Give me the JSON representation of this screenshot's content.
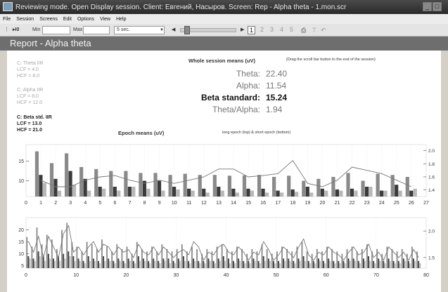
{
  "window": {
    "title": "Reviewing mode. Open Display session. Client: Евгений, Насыров. Screen: Rep - Alpha theta - 1.mon.scr"
  },
  "menu": [
    "File",
    "Session",
    "Screens",
    "Edit",
    "Options",
    "View",
    "Help"
  ],
  "toolbar": {
    "min_label": "Min",
    "max_label": "Max",
    "interval": "5 sec.",
    "pages": [
      "1",
      "2",
      "3",
      "4",
      "5"
    ]
  },
  "report": {
    "title": "Report - Alpha theta"
  },
  "filters": [
    {
      "name": "C: Theta IIR",
      "lcf": "LCF = 4.0",
      "hcf": "HCF = 8.0",
      "color": "#a8a8a8"
    },
    {
      "name": "C: Alpha IIR",
      "lcf": "LCF = 8.0",
      "hcf": "HCF = 12.0",
      "color": "#a8a8a8"
    },
    {
      "name": "C: Beta std. IIR",
      "lcf": "LCF = 13.0",
      "hcf": "HCF = 21.0",
      "color": "#222222"
    }
  ],
  "session": {
    "title": "Whole session means (uV)",
    "hint": "(Drag the scroll bar button to the end of the session)",
    "metrics": [
      {
        "label": "Theta:",
        "value": "22.40",
        "emph": false
      },
      {
        "label": "Alpha:",
        "value": "11.54",
        "emph": false
      },
      {
        "label": "Beta standard:",
        "value": "15.24",
        "emph": true
      },
      {
        "label": "Theta/Alpha:",
        "value": "1.94",
        "emph": false
      }
    ]
  },
  "epoch": {
    "title": "Epoch means (uV)",
    "note": "long epoch (top) & short epoch (bottom)"
  },
  "chart_data": [
    {
      "type": "bar",
      "title": "long epoch",
      "x": [
        1,
        2,
        3,
        4,
        5,
        6,
        7,
        8,
        9,
        10,
        11,
        12,
        13,
        14,
        15,
        16,
        17,
        18,
        19,
        20,
        21,
        22,
        23,
        24,
        25,
        26
      ],
      "xticks": [
        "0",
        "1",
        "2",
        "3",
        "4",
        "5",
        "6",
        "7",
        "8",
        "9",
        "10",
        "11",
        "12",
        "13",
        "14",
        "15",
        "16",
        "17",
        "18",
        "19",
        "20",
        "21",
        "22",
        "23",
        "24",
        "25",
        "26",
        "27"
      ],
      "yticks_left": [
        "10",
        "15"
      ],
      "yticks_right": [
        "1.4",
        "1.6",
        "1.8",
        "2.0"
      ],
      "ylim_left": [
        6,
        18.5
      ],
      "ylim_right": [
        1.3,
        2.05
      ],
      "series": [
        {
          "name": "Theta",
          "color": "#8a8a8a",
          "values": [
            17.5,
            14.5,
            17,
            13.5,
            13,
            12.5,
            12.5,
            12,
            12,
            11.5,
            11.8,
            11.5,
            11.5,
            11.3,
            11.4,
            11.5,
            11,
            11.3,
            10,
            10.5,
            11,
            12,
            10,
            11.8,
            11.5,
            11
          ]
        },
        {
          "name": "Alpha",
          "color": "#3a3a3a",
          "values": [
            11.5,
            10.5,
            12.5,
            10.5,
            8.5,
            8.5,
            8.5,
            10,
            10,
            8.5,
            8,
            8,
            8.5,
            8,
            8,
            8,
            7.5,
            7.8,
            8.5,
            8,
            7.8,
            8,
            8.5,
            7.5,
            9,
            7.5
          ]
        },
        {
          "name": "Beta",
          "color": "#b8b8b8",
          "values": [
            9.5,
            7.5,
            9,
            7.5,
            8,
            7.5,
            8.5,
            8,
            7.5,
            7.8,
            7.5,
            7,
            7.5,
            7,
            7.5,
            7,
            7,
            7.2,
            7,
            7.5,
            7.5,
            7.5,
            8.5,
            7.5,
            7.5,
            8
          ]
        }
      ],
      "ratio": [
        1.55,
        1.45,
        1.45,
        1.55,
        1.6,
        1.62,
        1.55,
        1.5,
        1.55,
        1.5,
        1.55,
        1.6,
        1.72,
        1.72,
        1.6,
        1.62,
        1.65,
        1.85,
        1.5,
        1.45,
        1.55,
        1.75,
        1.7,
        1.65,
        1.55,
        1.45
      ]
    },
    {
      "type": "bar",
      "title": "short epoch",
      "xticks": [
        "0",
        "10",
        "20",
        "30",
        "40",
        "50",
        "60",
        "70",
        "80"
      ],
      "yticks_left": [
        "5",
        "10",
        "15",
        "20"
      ],
      "yticks_right": [
        "1.5",
        "2.0"
      ],
      "ylim_left": [
        4,
        24
      ],
      "ylim_right": [
        1.3,
        2.2
      ],
      "series": [
        {
          "name": "Theta",
          "color": "#8a8a8a",
          "values": [
            17,
            13,
            21,
            14,
            18,
            16,
            12,
            20,
            23,
            15,
            13,
            11,
            15,
            14,
            12,
            16,
            13,
            11,
            14,
            12,
            13,
            10,
            15,
            12,
            11,
            13,
            11,
            14,
            12,
            11,
            12,
            14,
            11,
            13,
            12,
            10,
            12,
            11,
            13,
            14,
            12,
            11,
            13,
            12,
            10,
            12,
            11,
            14,
            12,
            10,
            11,
            13,
            12,
            11,
            13,
            15,
            11,
            10,
            12,
            11,
            13,
            12,
            11,
            10,
            12,
            13,
            11,
            12,
            14,
            11,
            12,
            10,
            13,
            12,
            11,
            12,
            10,
            13,
            11
          ]
        },
        {
          "name": "Alpha",
          "color": "#3a3a3a",
          "values": [
            9,
            8,
            11,
            9,
            10,
            8,
            9,
            10,
            11,
            9,
            8,
            7,
            9,
            8,
            7,
            9,
            8,
            7,
            8,
            7,
            8,
            7,
            9,
            8,
            7,
            8,
            7,
            8,
            8,
            7,
            8,
            9,
            7,
            8,
            7,
            7,
            8,
            7,
            8,
            9,
            8,
            7,
            8,
            7,
            7,
            8,
            7,
            9,
            8,
            7,
            7,
            8,
            8,
            7,
            8,
            9,
            7,
            7,
            8,
            7,
            8,
            7,
            7,
            7,
            8,
            8,
            7,
            8,
            9,
            7,
            8,
            7,
            8,
            7,
            7,
            8,
            7,
            8,
            7
          ]
        },
        {
          "name": "Beta",
          "color": "#b8b8b8",
          "values": [
            8,
            7,
            9,
            7,
            8,
            7,
            7,
            8,
            9,
            7,
            7,
            6,
            7,
            7,
            6,
            7,
            7,
            6,
            7,
            6,
            7,
            6,
            7,
            7,
            6,
            7,
            6,
            7,
            6,
            6,
            7,
            7,
            6,
            7,
            6,
            6,
            7,
            6,
            7,
            7,
            6,
            6,
            7,
            6,
            6,
            7,
            6,
            7,
            7,
            6,
            6,
            7,
            7,
            6,
            7,
            7,
            6,
            6,
            7,
            6,
            7,
            6,
            6,
            6,
            7,
            7,
            6,
            7,
            7,
            6,
            7,
            6,
            7,
            6,
            6,
            7,
            6,
            7,
            6
          ]
        }
      ],
      "ratio": [
        1.8,
        1.6,
        1.9,
        1.5,
        1.9,
        1.7,
        1.5,
        1.95,
        2.1,
        1.6,
        1.7,
        1.55,
        1.7,
        1.8,
        1.6,
        1.75,
        1.7,
        1.55,
        1.7,
        1.6,
        1.65,
        1.5,
        1.75,
        1.6,
        1.55,
        1.7,
        1.55,
        1.7,
        1.6,
        1.5,
        1.6,
        1.65,
        1.55,
        1.8,
        1.7,
        1.45,
        1.6,
        1.55,
        1.7,
        1.75,
        1.6,
        1.55,
        1.7,
        1.6,
        1.45,
        1.6,
        1.55,
        1.8,
        1.65,
        1.45,
        1.55,
        1.7,
        1.6,
        1.5,
        1.7,
        1.85,
        1.55,
        1.45,
        1.6,
        1.55,
        1.7,
        1.6,
        1.55,
        1.45,
        1.6,
        1.7,
        1.55,
        1.6,
        1.75,
        1.5,
        1.6,
        1.45,
        1.7,
        1.6,
        1.5,
        1.6,
        1.45,
        1.65,
        1.5
      ]
    }
  ]
}
